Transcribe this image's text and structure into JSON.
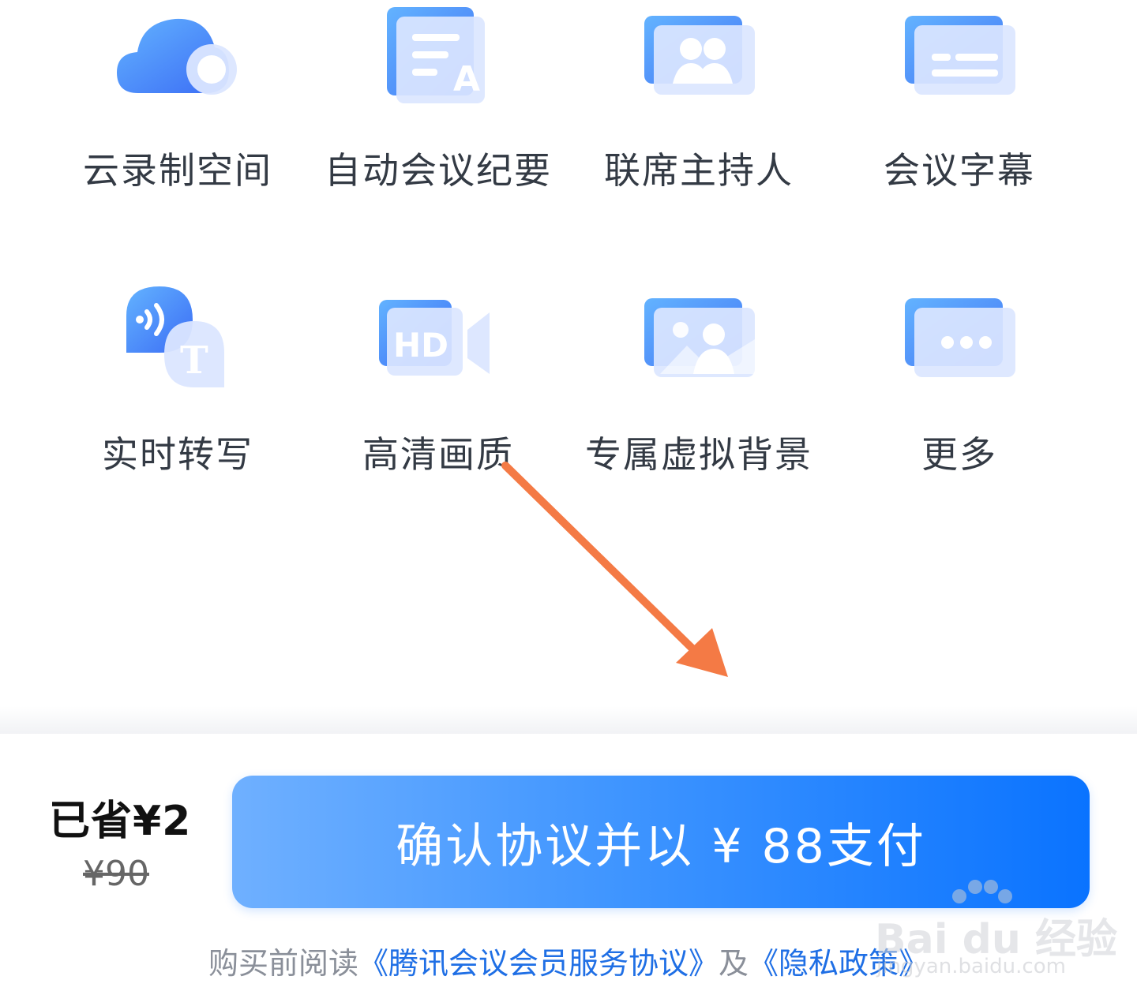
{
  "features": [
    {
      "label": "云录制空间",
      "icon": "cloud-record-icon"
    },
    {
      "label": "自动会议纪要",
      "icon": "auto-minutes-icon"
    },
    {
      "label": "联席主持人",
      "icon": "co-host-icon"
    },
    {
      "label": "会议字幕",
      "icon": "subtitles-icon"
    },
    {
      "label": "实时转写",
      "icon": "transcription-icon"
    },
    {
      "label": "高清画质",
      "icon": "hd-video-icon"
    },
    {
      "label": "专属虚拟背景",
      "icon": "virtual-background-icon"
    },
    {
      "label": "更多",
      "icon": "more-icon"
    }
  ],
  "pricing": {
    "saved": "已省¥2",
    "original_price": "¥90",
    "pay_button_label": "确认协议并以 ¥ 88支付"
  },
  "agreement": {
    "prefix": "购买前阅读",
    "membership_link": "《腾讯会议会员服务协议》",
    "conjunction": "及",
    "privacy_link": "《隐私政策》"
  },
  "watermark": {
    "text": "Bai du 经验",
    "url": "jingyan.baidu.com"
  },
  "colors": {
    "primary": "#0a73ff",
    "annotation_arrow": "#f47a45",
    "link": "#1f6fe5"
  }
}
